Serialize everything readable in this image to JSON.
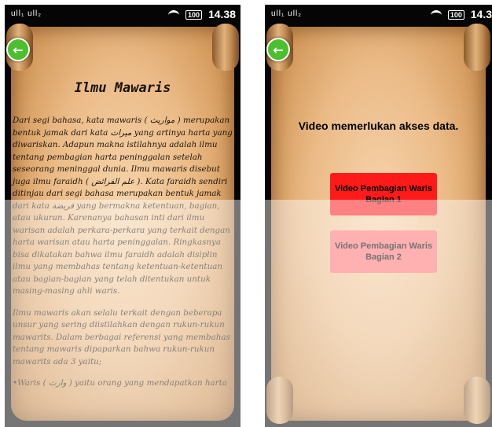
{
  "status_bar": {
    "signal": "ull₁ ull₂",
    "battery": "100",
    "time_left": "14.38",
    "time_right": "14.3"
  },
  "left_screen": {
    "title": "Ilmu Mawaris",
    "paragraphs": [
      "Dari segi bahasa, kata mawaris ( مواريث ) merupakan bentuk jamak dari kata ميراث yang artinya harta yang diwariskan. Adapun makna istilahnya adalah ilmu tentang pembagian harta peninggalan setelah seseorang meninggal dunia. Ilmu mawaris disebut juga ilmu faraidh ( علم الفرائض ). Kata faraidh sendiri ditinjau dari segi bahasa merupakan bentuk jamak dari kata فريضة yang bermakna ketentuan, bagian, atau ukuran. Karenanya bahasan inti dari ilmu warisan adalah perkara-perkara yang terkait dengan harta warisan atau harta peninggalan. Ringkasnya bisa dikatakan bahwa ilmu faraidh adalah disiplin ilmu yang membahas tentang ketentuan-ketentuan atau bagian-bagian yang telah ditentukan untuk masing-masing ahli waris.",
      "Ilmu mawaris akan selalu terkait dengan beberapa unsur yang sering diistilahkan dengan rukun-rukun mawarits. Dalam berbagai referensi yang membahas tentang mawaris dipaparkan bahwa rukun-rukun mawarits ada 3 yaitu;",
      "•Waris ( وارث ) yaitu orang yang mendapatkan harta"
    ]
  },
  "right_screen": {
    "notice": "Video memerlukan akses data.",
    "buttons": [
      "Video Pembagian Waris Bagian 1",
      "Video Pembagian Waris Bagian 2"
    ]
  },
  "colors": {
    "button_1": "#ff1a1a",
    "button_2": "#ff6f6f",
    "back_button": "#4cbf2f"
  },
  "icons": [
    "back-arrow-icon",
    "wifi-icon",
    "battery-icon",
    "image-icon"
  ]
}
